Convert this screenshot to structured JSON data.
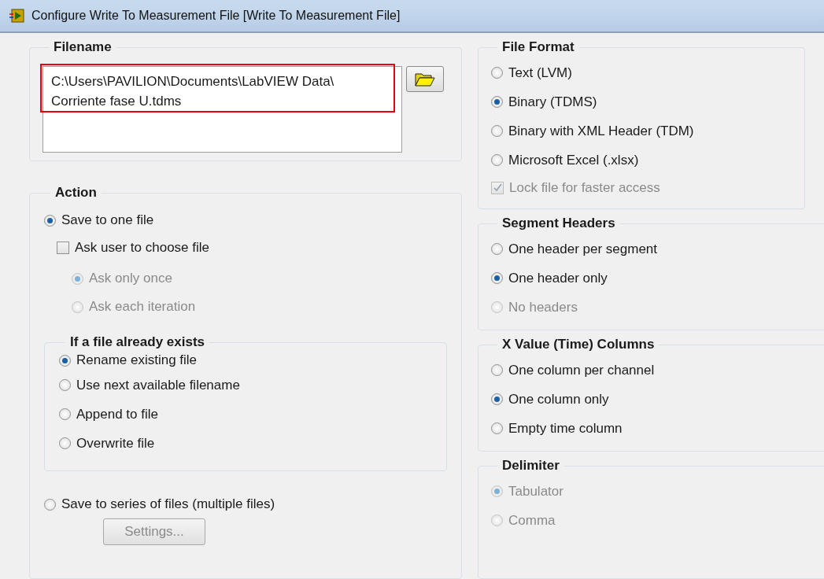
{
  "window": {
    "title": "Configure Write To Measurement File [Write To Measurement File]"
  },
  "filename": {
    "title": "Filename",
    "value": "C:\\Users\\PAVILION\\Documents\\LabVIEW Data\\\nCorriente fase U.tdms",
    "highlighted": true
  },
  "action": {
    "title": "Action",
    "save_one": {
      "label": "Save to one file",
      "selected": true
    },
    "ask_user": {
      "label": "Ask user to choose file",
      "checked": false
    },
    "ask_mode": [
      {
        "label": "Ask only once",
        "selected": true,
        "disabled": true
      },
      {
        "label": "Ask each iteration",
        "selected": false,
        "disabled": true
      }
    ],
    "if_exists": {
      "title": "If a file already exists",
      "options": [
        {
          "label": "Rename existing file",
          "selected": true,
          "disabled": false
        },
        {
          "label": "Use next available filename",
          "selected": false,
          "disabled": false
        },
        {
          "label": "Append to file",
          "selected": false,
          "disabled": false
        },
        {
          "label": "Overwrite file",
          "selected": false,
          "disabled": false
        }
      ]
    },
    "save_series": {
      "label": "Save to series of files (multiple files)",
      "selected": false
    },
    "settings_button": {
      "label": "Settings...",
      "disabled": true
    }
  },
  "right_groups": [
    {
      "title": "File Format",
      "items": [
        {
          "kind": "radio",
          "label": "Text (LVM)",
          "selected": false,
          "disabled": false
        },
        {
          "kind": "radio",
          "label": "Binary (TDMS)",
          "selected": true,
          "disabled": false
        },
        {
          "kind": "radio",
          "label": "Binary with XML Header (TDM)",
          "selected": false,
          "disabled": false
        },
        {
          "kind": "radio",
          "label": "Microsoft Excel (.xlsx)",
          "selected": false,
          "disabled": false
        },
        {
          "kind": "checkbox",
          "label": "Lock file for faster access",
          "checked": true,
          "disabled": true
        }
      ]
    },
    {
      "title": "Segment Headers",
      "items": [
        {
          "kind": "radio",
          "label": "One header per segment",
          "selected": false,
          "disabled": false
        },
        {
          "kind": "radio",
          "label": "One header only",
          "selected": true,
          "disabled": false
        },
        {
          "kind": "radio",
          "label": "No headers",
          "selected": false,
          "disabled": true
        }
      ]
    },
    {
      "title": "X Value (Time) Columns",
      "items": [
        {
          "kind": "radio",
          "label": "One column per channel",
          "selected": false,
          "disabled": false
        },
        {
          "kind": "radio",
          "label": "One column only",
          "selected": true,
          "disabled": false
        },
        {
          "kind": "radio",
          "label": "Empty time column",
          "selected": false,
          "disabled": false
        }
      ]
    },
    {
      "title": "Delimiter",
      "items": [
        {
          "kind": "radio",
          "label": "Tabulator",
          "selected": true,
          "disabled": true
        },
        {
          "kind": "radio",
          "label": "Comma",
          "selected": false,
          "disabled": true
        }
      ]
    }
  ]
}
